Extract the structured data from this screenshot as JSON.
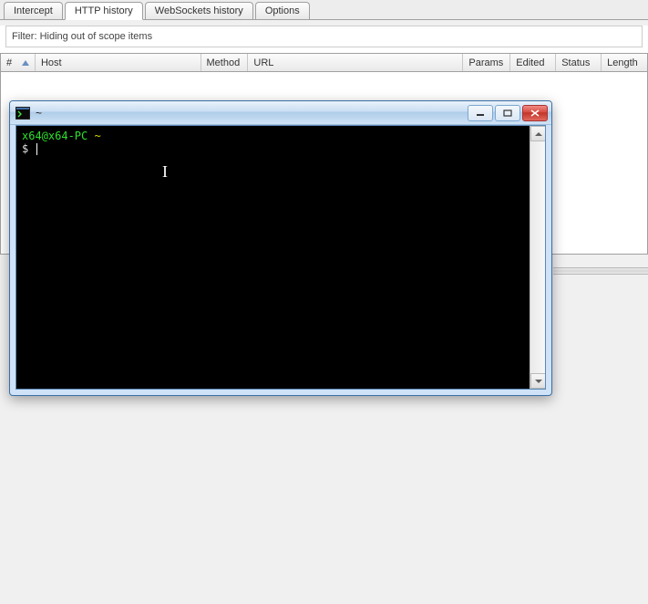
{
  "tabs": {
    "intercept": "Intercept",
    "http_history": "HTTP history",
    "websockets_history": "WebSockets history",
    "options": "Options"
  },
  "filter": {
    "label": "Filter:",
    "value": "Hiding out of scope items"
  },
  "columns": {
    "num": "#",
    "host": "Host",
    "method": "Method",
    "url": "URL",
    "params": "Params",
    "edited": "Edited",
    "status": "Status",
    "length": "Length"
  },
  "terminal": {
    "title": "~",
    "prompt_user": "x64@x64-PC",
    "prompt_path": "~",
    "prompt_symbol": "$"
  }
}
